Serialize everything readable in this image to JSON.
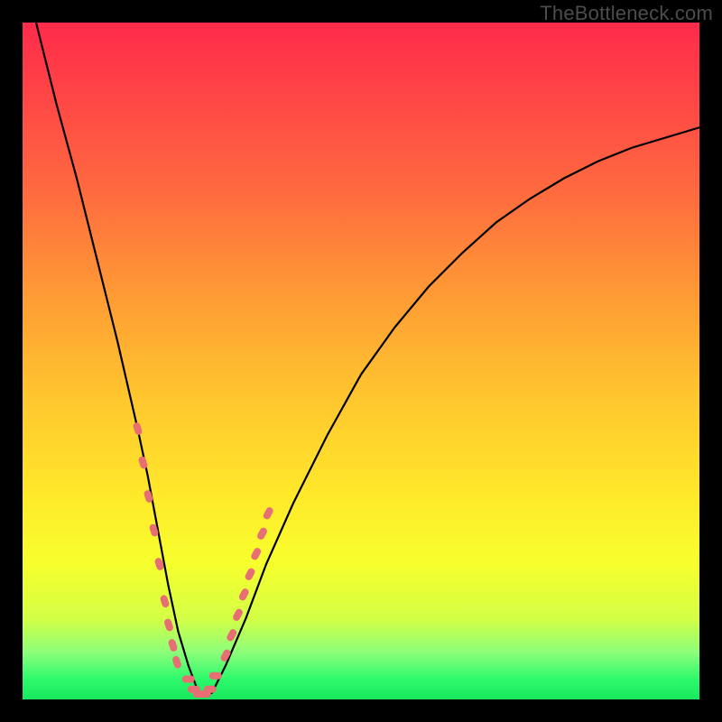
{
  "watermark": "TheBottleneck.com",
  "chart_data": {
    "type": "line",
    "title": "",
    "xlabel": "",
    "ylabel": "",
    "xlim": [
      0,
      100
    ],
    "ylim": [
      0,
      100
    ],
    "grid": false,
    "legend": false,
    "series": [
      {
        "name": "bottleneck-curve",
        "x": [
          2,
          5,
          8,
          11,
          14,
          17,
          18.5,
          20,
          21.5,
          23,
          24.5,
          26,
          27,
          28,
          30,
          33,
          36,
          40,
          45,
          50,
          55,
          60,
          65,
          70,
          75,
          80,
          85,
          90,
          95,
          100
        ],
        "y": [
          100,
          88,
          77,
          65,
          53,
          40,
          33,
          25,
          17,
          10,
          5,
          1,
          0.5,
          1,
          5,
          12,
          20,
          29,
          39,
          48,
          55,
          61,
          66,
          70.5,
          74,
          77,
          79.5,
          81.5,
          83,
          84.5
        ]
      }
    ],
    "markers": [
      {
        "name": "left-cluster",
        "x": [
          17.0,
          17.8,
          18.6,
          19.4,
          20.2,
          21.0,
          21.6,
          22.2,
          22.8
        ],
        "y": [
          40.0,
          35.0,
          30.0,
          25.0,
          20.0,
          14.5,
          11.0,
          8.0,
          5.5
        ]
      },
      {
        "name": "bottom-cluster",
        "x": [
          24.5,
          25.3,
          26.1,
          26.9,
          27.7,
          28.5
        ],
        "y": [
          3.0,
          1.5,
          0.8,
          0.8,
          1.5,
          3.5
        ]
      },
      {
        "name": "right-cluster",
        "x": [
          30.0,
          30.9,
          31.8,
          32.7,
          33.6,
          34.5,
          35.4,
          36.3
        ],
        "y": [
          6.5,
          9.5,
          12.5,
          15.5,
          18.5,
          21.5,
          24.5,
          27.5
        ]
      }
    ],
    "marker_color": "#e76f74",
    "curve_color": "#000000",
    "background": "gradient-red-yellow-green",
    "frame_color": "#000000"
  }
}
